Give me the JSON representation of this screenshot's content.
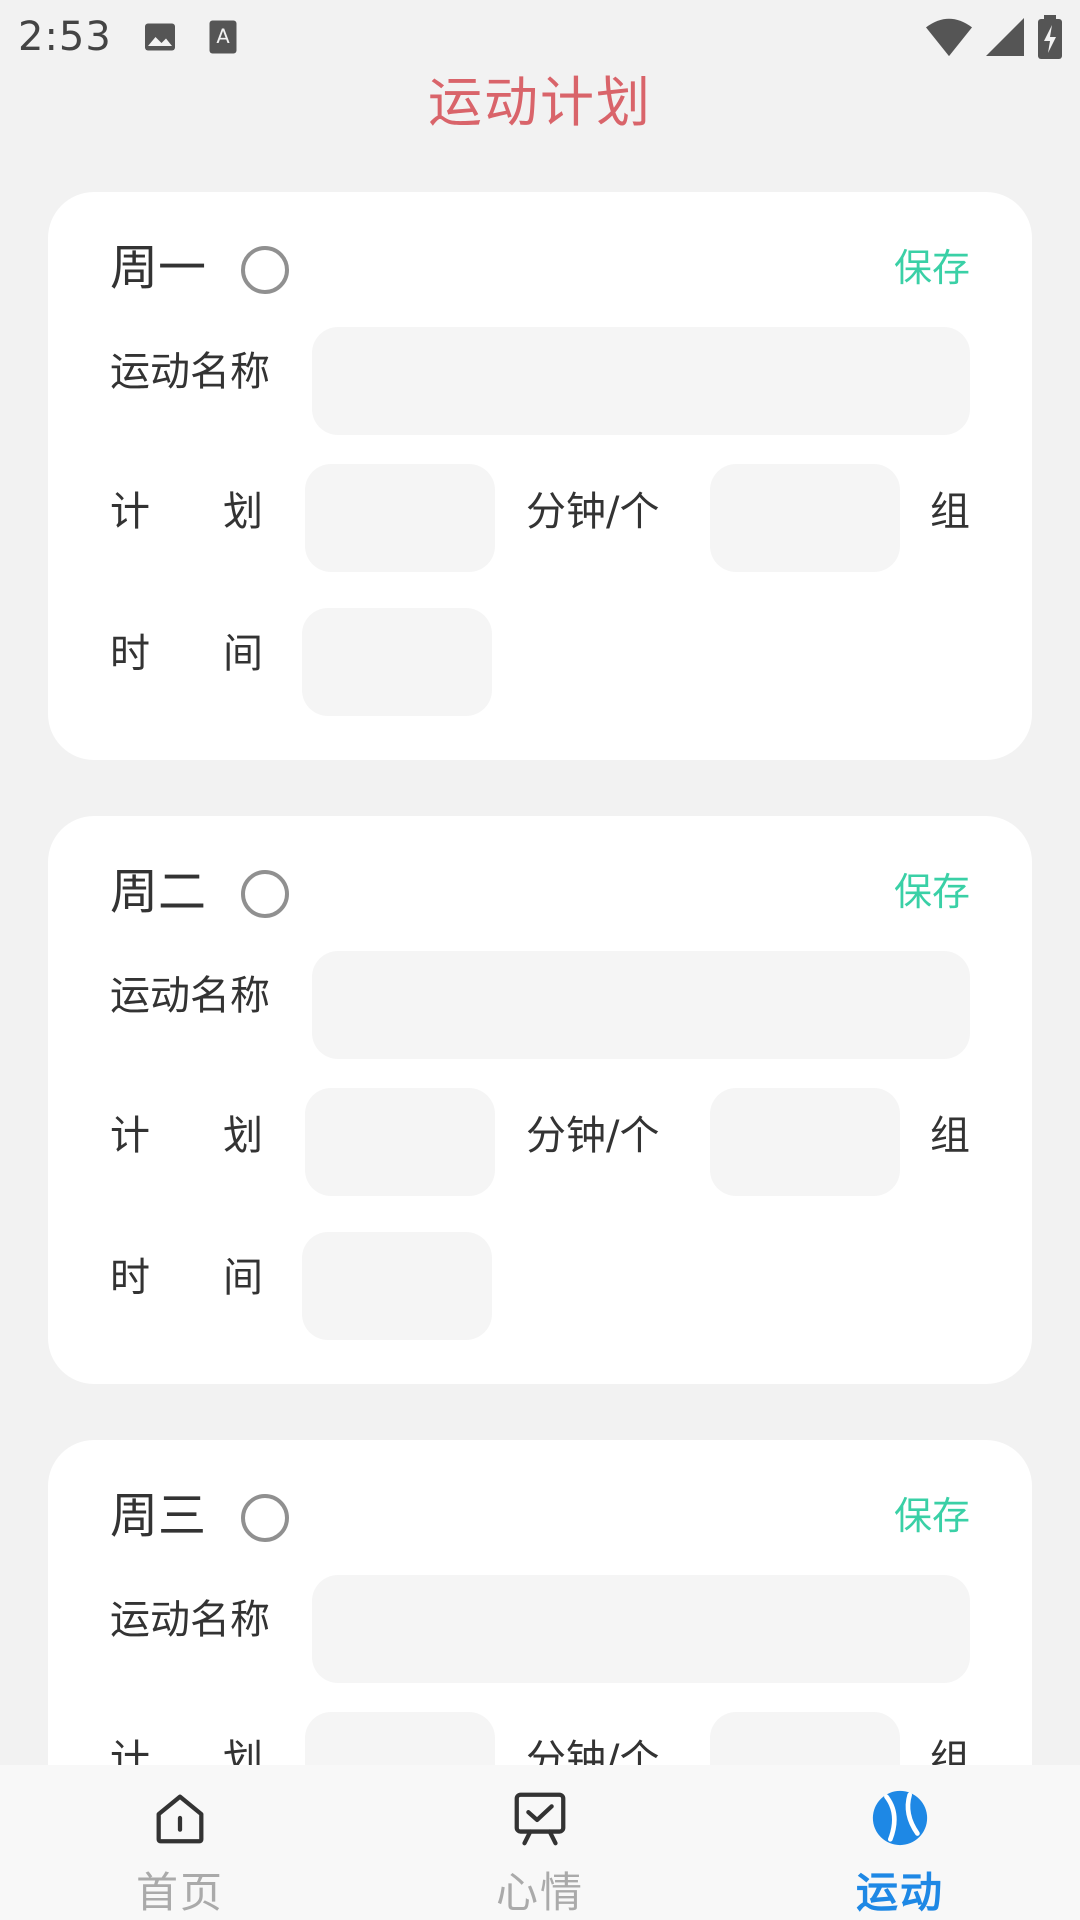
{
  "status_bar": {
    "time": "2:53",
    "icons": [
      "image-icon",
      "keyboard-a-icon",
      "wifi-icon",
      "signal-icon",
      "battery-charging-icon"
    ]
  },
  "header": {
    "title": "运动计划"
  },
  "labels": {
    "exercise_name": "运动名称",
    "plan_a": "计",
    "plan_b": "划",
    "unit_per": "分钟/个",
    "unit_group": "组",
    "time_a": "时",
    "time_b": "间",
    "save": "保存"
  },
  "days": [
    {
      "label": "周一",
      "exercise_name": "",
      "plan_amount": "",
      "plan_groups": "",
      "time": ""
    },
    {
      "label": "周二",
      "exercise_name": "",
      "plan_amount": "",
      "plan_groups": "",
      "time": ""
    },
    {
      "label": "周三",
      "exercise_name": "",
      "plan_amount": "",
      "plan_groups": "",
      "time": ""
    }
  ],
  "bottom_nav": {
    "items": [
      {
        "label": "首页",
        "icon": "home-icon",
        "active": false
      },
      {
        "label": "心情",
        "icon": "mood-board-icon",
        "active": false
      },
      {
        "label": "运动",
        "icon": "sport-ball-icon",
        "active": true
      }
    ]
  },
  "colors": {
    "title": "#d9646a",
    "save": "#3ad0a6",
    "nav_active": "#1e88e5",
    "nav_inactive": "#aaaaaa"
  }
}
